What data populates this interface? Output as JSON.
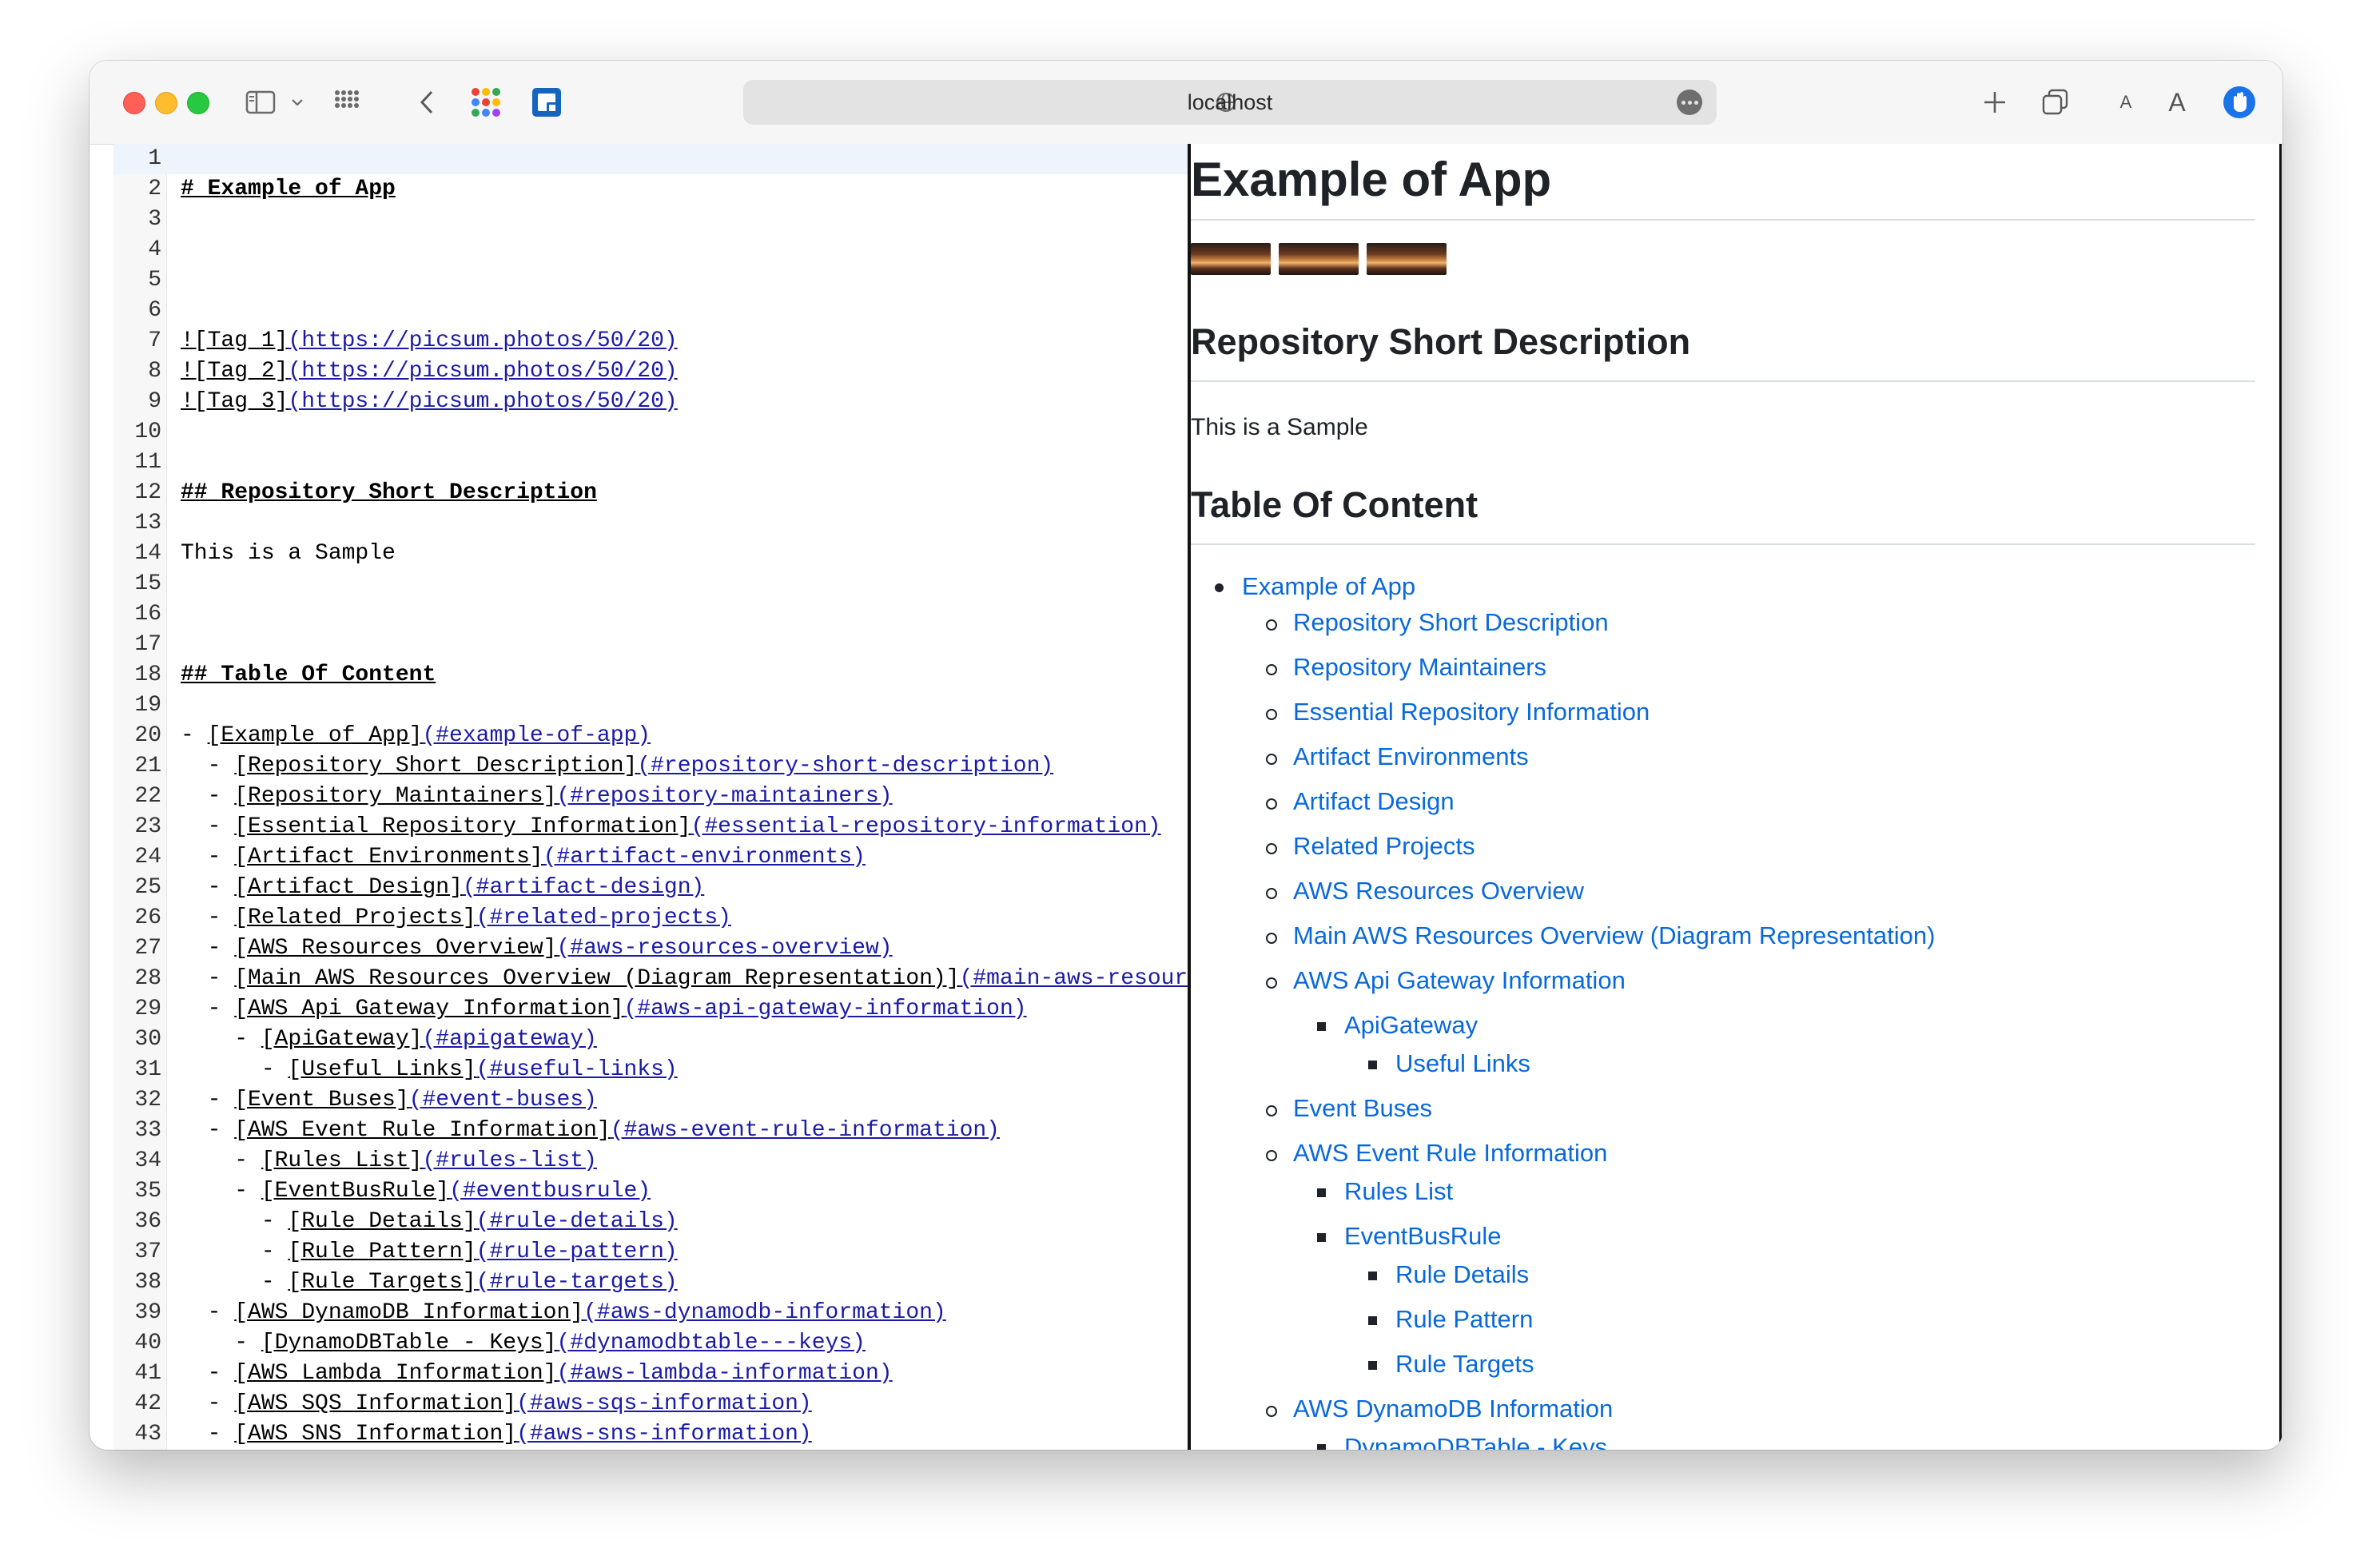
{
  "browser": {
    "address": "localhost",
    "icons": [
      "sidebar-icon",
      "chevron-down-icon",
      "tab-grid-icon",
      "back-icon",
      "apps-icon",
      "extension-icon",
      "globe-icon",
      "more-icon",
      "new-tab-icon",
      "tab-overview-icon",
      "text-smaller-icon",
      "text-larger-icon",
      "privacy-icon"
    ],
    "text_smaller": "A",
    "text_larger": "A"
  },
  "editor": {
    "lines": [
      {
        "n": "1",
        "parts": []
      },
      {
        "n": "2",
        "parts": [
          {
            "t": "# Example of App",
            "c": "h"
          }
        ]
      },
      {
        "n": "3",
        "parts": []
      },
      {
        "n": "4",
        "parts": []
      },
      {
        "n": "5",
        "parts": []
      },
      {
        "n": "6",
        "parts": []
      },
      {
        "n": "7",
        "parts": [
          {
            "t": "![Tag 1]",
            "c": "lk"
          },
          {
            "t": "(https://picsum.photos/50/20)",
            "c": "u"
          }
        ]
      },
      {
        "n": "8",
        "parts": [
          {
            "t": "![Tag 2]",
            "c": "lk"
          },
          {
            "t": "(https://picsum.photos/50/20)",
            "c": "u"
          }
        ]
      },
      {
        "n": "9",
        "parts": [
          {
            "t": "![Tag 3]",
            "c": "lk"
          },
          {
            "t": "(https://picsum.photos/50/20)",
            "c": "u"
          }
        ]
      },
      {
        "n": "10",
        "parts": []
      },
      {
        "n": "11",
        "parts": []
      },
      {
        "n": "12",
        "parts": [
          {
            "t": "## Repository Short Description",
            "c": "h"
          }
        ]
      },
      {
        "n": "13",
        "parts": []
      },
      {
        "n": "14",
        "parts": [
          {
            "t": "This is a Sample",
            "c": "b"
          }
        ]
      },
      {
        "n": "15",
        "parts": []
      },
      {
        "n": "16",
        "parts": []
      },
      {
        "n": "17",
        "parts": []
      },
      {
        "n": "18",
        "parts": [
          {
            "t": "## Table Of Content",
            "c": "h"
          }
        ]
      },
      {
        "n": "19",
        "parts": []
      },
      {
        "n": "20",
        "parts": [
          {
            "t": "- ",
            "c": "b"
          },
          {
            "t": "[Example of App]",
            "c": "lk"
          },
          {
            "t": "(#example-of-app)",
            "c": "u"
          }
        ]
      },
      {
        "n": "21",
        "parts": [
          {
            "t": "  - ",
            "c": "b"
          },
          {
            "t": "[Repository Short Description]",
            "c": "lk"
          },
          {
            "t": "(#repository-short-description)",
            "c": "u"
          }
        ]
      },
      {
        "n": "22",
        "parts": [
          {
            "t": "  - ",
            "c": "b"
          },
          {
            "t": "[Repository Maintainers]",
            "c": "lk"
          },
          {
            "t": "(#repository-maintainers)",
            "c": "u"
          }
        ]
      },
      {
        "n": "23",
        "parts": [
          {
            "t": "  - ",
            "c": "b"
          },
          {
            "t": "[Essential Repository Information]",
            "c": "lk"
          },
          {
            "t": "(#essential-repository-information)",
            "c": "u"
          }
        ]
      },
      {
        "n": "24",
        "parts": [
          {
            "t": "  - ",
            "c": "b"
          },
          {
            "t": "[Artifact Environments]",
            "c": "lk"
          },
          {
            "t": "(#artifact-environments)",
            "c": "u"
          }
        ]
      },
      {
        "n": "25",
        "parts": [
          {
            "t": "  - ",
            "c": "b"
          },
          {
            "t": "[Artifact Design]",
            "c": "lk"
          },
          {
            "t": "(#artifact-design)",
            "c": "u"
          }
        ]
      },
      {
        "n": "26",
        "parts": [
          {
            "t": "  - ",
            "c": "b"
          },
          {
            "t": "[Related Projects]",
            "c": "lk"
          },
          {
            "t": "(#related-projects)",
            "c": "u"
          }
        ]
      },
      {
        "n": "27",
        "parts": [
          {
            "t": "  - ",
            "c": "b"
          },
          {
            "t": "[AWS Resources Overview]",
            "c": "lk"
          },
          {
            "t": "(#aws-resources-overview)",
            "c": "u"
          }
        ]
      },
      {
        "n": "28",
        "parts": [
          {
            "t": "  - ",
            "c": "b"
          },
          {
            "t": "[Main AWS Resources Overview (Diagram Representation)]",
            "c": "lk"
          },
          {
            "t": "(#main-aws-resour",
            "c": "u"
          }
        ]
      },
      {
        "n": "29",
        "parts": [
          {
            "t": "  - ",
            "c": "b"
          },
          {
            "t": "[AWS Api Gateway Information]",
            "c": "lk"
          },
          {
            "t": "(#aws-api-gateway-information)",
            "c": "u"
          }
        ]
      },
      {
        "n": "30",
        "parts": [
          {
            "t": "    - ",
            "c": "b"
          },
          {
            "t": "[ApiGateway]",
            "c": "lk"
          },
          {
            "t": "(#apigateway)",
            "c": "u"
          }
        ]
      },
      {
        "n": "31",
        "parts": [
          {
            "t": "      - ",
            "c": "b"
          },
          {
            "t": "[Useful Links]",
            "c": "lk"
          },
          {
            "t": "(#useful-links)",
            "c": "u"
          }
        ]
      },
      {
        "n": "32",
        "parts": [
          {
            "t": "  - ",
            "c": "b"
          },
          {
            "t": "[Event Buses]",
            "c": "lk"
          },
          {
            "t": "(#event-buses)",
            "c": "u"
          }
        ]
      },
      {
        "n": "33",
        "parts": [
          {
            "t": "  - ",
            "c": "b"
          },
          {
            "t": "[AWS Event Rule Information]",
            "c": "lk"
          },
          {
            "t": "(#aws-event-rule-information)",
            "c": "u"
          }
        ]
      },
      {
        "n": "34",
        "parts": [
          {
            "t": "    - ",
            "c": "b"
          },
          {
            "t": "[Rules List]",
            "c": "lk"
          },
          {
            "t": "(#rules-list)",
            "c": "u"
          }
        ]
      },
      {
        "n": "35",
        "parts": [
          {
            "t": "    - ",
            "c": "b"
          },
          {
            "t": "[EventBusRule]",
            "c": "lk"
          },
          {
            "t": "(#eventbusrule)",
            "c": "u"
          }
        ]
      },
      {
        "n": "36",
        "parts": [
          {
            "t": "      - ",
            "c": "b"
          },
          {
            "t": "[Rule Details]",
            "c": "lk"
          },
          {
            "t": "(#rule-details)",
            "c": "u"
          }
        ]
      },
      {
        "n": "37",
        "parts": [
          {
            "t": "      - ",
            "c": "b"
          },
          {
            "t": "[Rule Pattern]",
            "c": "lk"
          },
          {
            "t": "(#rule-pattern)",
            "c": "u"
          }
        ]
      },
      {
        "n": "38",
        "parts": [
          {
            "t": "      - ",
            "c": "b"
          },
          {
            "t": "[Rule Targets]",
            "c": "lk"
          },
          {
            "t": "(#rule-targets)",
            "c": "u"
          }
        ]
      },
      {
        "n": "39",
        "parts": [
          {
            "t": "  - ",
            "c": "b"
          },
          {
            "t": "[AWS DynamoDB Information]",
            "c": "lk"
          },
          {
            "t": "(#aws-dynamodb-information)",
            "c": "u"
          }
        ]
      },
      {
        "n": "40",
        "parts": [
          {
            "t": "    - ",
            "c": "b"
          },
          {
            "t": "[DynamoDBTable - Keys]",
            "c": "lk"
          },
          {
            "t": "(#dynamodbtable---keys)",
            "c": "u"
          }
        ]
      },
      {
        "n": "41",
        "parts": [
          {
            "t": "  - ",
            "c": "b"
          },
          {
            "t": "[AWS Lambda Information]",
            "c": "lk"
          },
          {
            "t": "(#aws-lambda-information)",
            "c": "u"
          }
        ]
      },
      {
        "n": "42",
        "parts": [
          {
            "t": "  - ",
            "c": "b"
          },
          {
            "t": "[AWS SQS Information]",
            "c": "lk"
          },
          {
            "t": "(#aws-sqs-information)",
            "c": "u"
          }
        ]
      },
      {
        "n": "43",
        "parts": [
          {
            "t": "  - ",
            "c": "b"
          },
          {
            "t": "[AWS SNS Information]",
            "c": "lk"
          },
          {
            "t": "(#aws-sns-information)",
            "c": "u"
          }
        ]
      }
    ]
  },
  "preview": {
    "title": "Example of App",
    "images": [
      "Tag 1",
      "Tag 2",
      "Tag 3"
    ],
    "section1": "Repository Short Description",
    "paragraph": "This is a Sample",
    "section2": "Table Of Content",
    "toc": [
      {
        "label": "Example of App",
        "level": 0
      },
      {
        "label": "Repository Short Description",
        "level": 1
      },
      {
        "label": "Repository Maintainers",
        "level": 1
      },
      {
        "label": "Essential Repository Information",
        "level": 1
      },
      {
        "label": "Artifact Environments",
        "level": 1
      },
      {
        "label": "Artifact Design",
        "level": 1
      },
      {
        "label": "Related Projects",
        "level": 1
      },
      {
        "label": "AWS Resources Overview",
        "level": 1
      },
      {
        "label": "Main AWS Resources Overview (Diagram Representation)",
        "level": 1
      },
      {
        "label": "AWS Api Gateway Information",
        "level": 1
      },
      {
        "label": "ApiGateway",
        "level": 2
      },
      {
        "label": "Useful Links",
        "level": 3
      },
      {
        "label": "Event Buses",
        "level": 1
      },
      {
        "label": "AWS Event Rule Information",
        "level": 1
      },
      {
        "label": "Rules List",
        "level": 2
      },
      {
        "label": "EventBusRule",
        "level": 2
      },
      {
        "label": "Rule Details",
        "level": 3
      },
      {
        "label": "Rule Pattern",
        "level": 3
      },
      {
        "label": "Rule Targets",
        "level": 3
      },
      {
        "label": "AWS DynamoDB Information",
        "level": 1
      },
      {
        "label": "DynamoDBTable - Keys",
        "level": 2
      }
    ]
  }
}
